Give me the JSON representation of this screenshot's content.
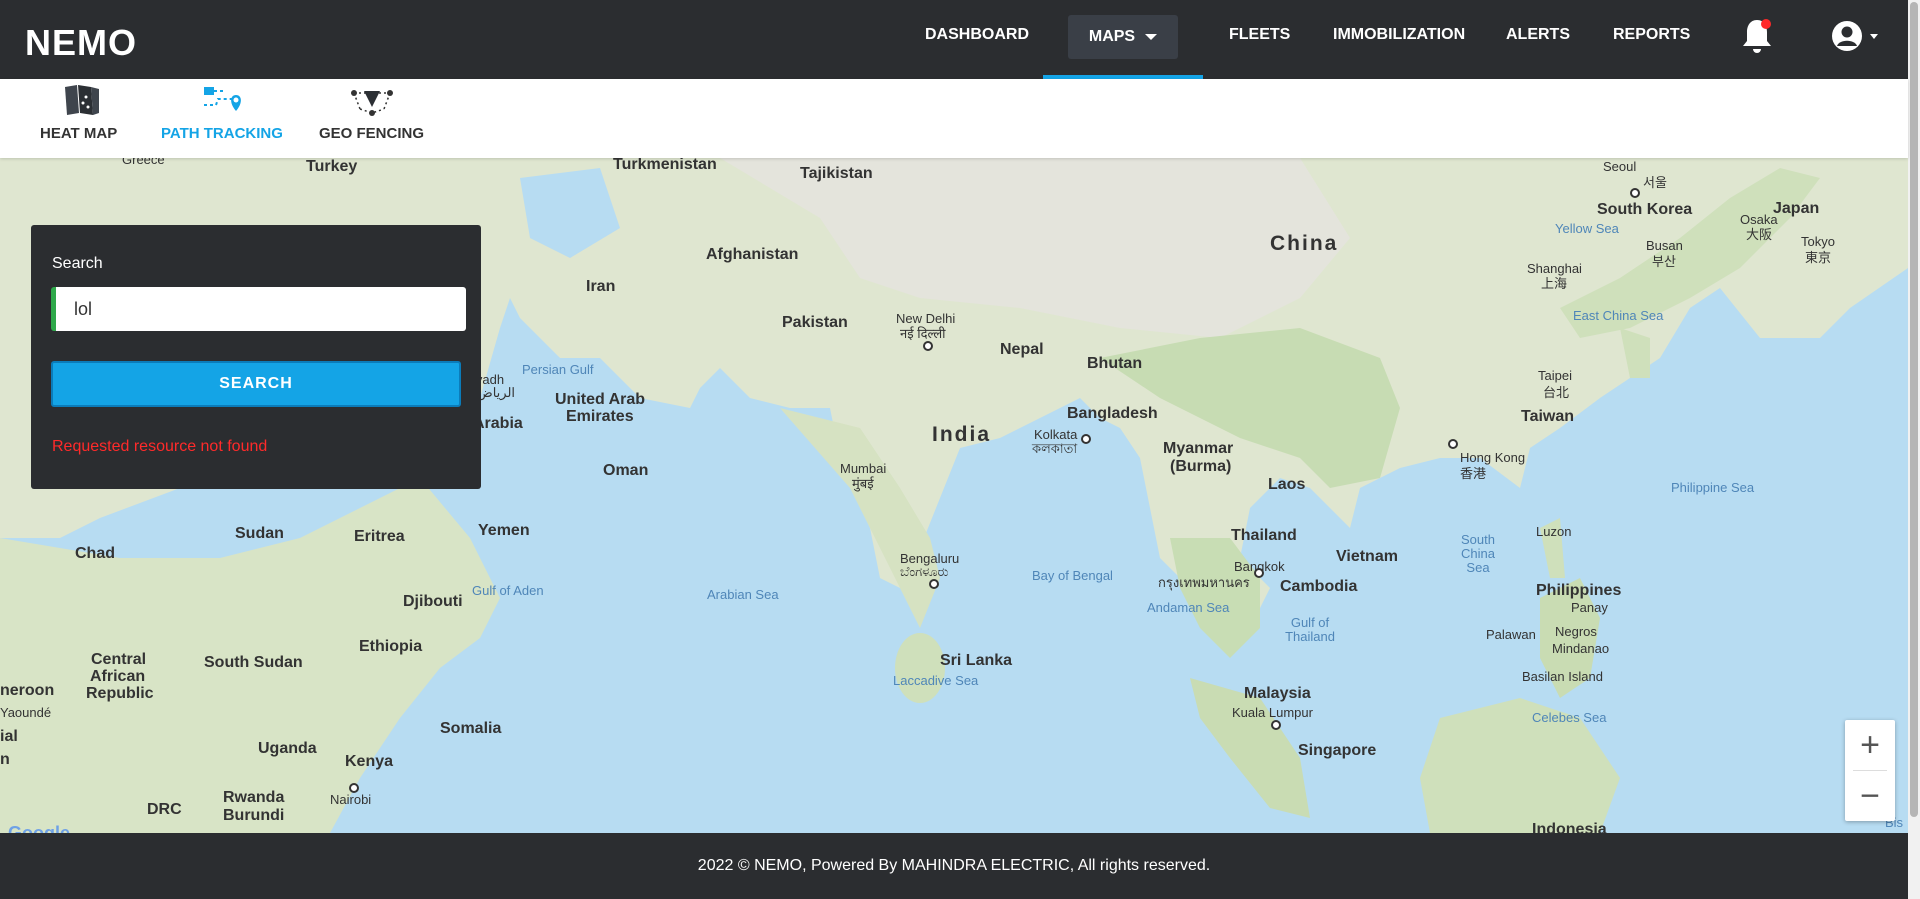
{
  "app": {
    "logo": "NEMO"
  },
  "nav": {
    "items": [
      {
        "label": "DASHBOARD"
      },
      {
        "label": "MAPS"
      },
      {
        "label": "FLEETS"
      },
      {
        "label": "IMMOBILIZATION"
      },
      {
        "label": "ALERTS"
      },
      {
        "label": "REPORTS"
      }
    ],
    "active": "MAPS",
    "accent": "#14a4e6",
    "bell_icon": "bell-icon",
    "account_icon": "user-circle-icon"
  },
  "submenu": {
    "items": [
      {
        "label": "HEAT MAP",
        "icon": "heat-map-icon"
      },
      {
        "label": "PATH TRACKING",
        "icon": "path-tracking-icon"
      },
      {
        "label": "GEO FENCING",
        "icon": "geo-fencing-icon"
      }
    ],
    "active": "PATH TRACKING"
  },
  "search": {
    "label": "Search",
    "value": "lol",
    "button_label": "SEARCH",
    "error": "Requested resource not found",
    "error_color": "#ff2a2a"
  },
  "map": {
    "labels": {
      "greece": "Greece",
      "turkey": "Turkey",
      "turkmenistan": "Turkmenistan",
      "tajikistan": "Tajikistan",
      "afghanistan": "Afghanistan",
      "iran": "Iran",
      "pakistan": "Pakistan",
      "china": "China",
      "new_delhi": "New Delhi",
      "new_delhi_hi": "नई दिल्ली",
      "nepal": "Nepal",
      "bhutan": "Bhutan",
      "bangladesh": "Bangladesh",
      "india": "India",
      "kolkata": "Kolkata",
      "kolkata_bn": "কলকাতা",
      "mumbai": "Mumbai",
      "mumbai_mr": "मुंबई",
      "myanmar": "Myanmar",
      "burma": "(Burma)",
      "laos": "Laos",
      "thailand": "Thailand",
      "vietnam": "Vietnam",
      "cambodia": "Cambodia",
      "bangkok": "Bangkok",
      "bangkok_th": "กรุงเทพมหานคร",
      "bengaluru": "Bengaluru",
      "bengaluru_kn": "ಬೆಂಗಳೂರು",
      "sri_lanka": "Sri Lanka",
      "laccadive": "Laccadive Sea",
      "arabian_sea": "Arabian Sea",
      "bay_of_bengal": "Bay of Bengal",
      "andaman_sea": "Andaman Sea",
      "gulf_thailand": "Gulf of Thailand",
      "malaysia": "Malaysia",
      "kuala_lumpur": "Kuala Lumpur",
      "singapore": "Singapore",
      "south_korea": "South Korea",
      "seoul": "Seoul",
      "seoul_ko": "서울",
      "japan": "Japan",
      "osaka": "Osaka",
      "osaka_ja": "大阪",
      "tokyo": "Tokyo",
      "tokyo_ja": "東京",
      "busan": "Busan",
      "busan_ko": "부산",
      "yellow_sea": "Yellow Sea",
      "shanghai": "Shanghai",
      "shanghai_zh": "上海",
      "east_china_sea": "East China Sea",
      "taipei": "Taipei",
      "taipei_zh": "台北",
      "taiwan": "Taiwan",
      "hong_kong": "Hong Kong",
      "hong_kong_zh": "香港",
      "philippine_sea": "Philippine Sea",
      "south_china_sea": "South China Sea",
      "luzon": "Luzon",
      "philippines": "Philippines",
      "panay": "Panay",
      "palawan": "Palawan",
      "negros": "Negros",
      "mindanao": "Mindanao",
      "basilan": "Basilan Island",
      "celebes": "Celebes Sea",
      "indonesia": "Indonesia",
      "uae": "United Arab",
      "emirates": "Emirates",
      "persian_gulf": "Persian Gulf",
      "riyadh": "iyadh",
      "riyadh_ar": "الرياض",
      "arabia": "Arabia",
      "oman": "Oman",
      "yemen": "Yemen",
      "eritrea": "Eritrea",
      "sudan": "Sudan",
      "chad": "Chad",
      "djibouti": "Djibouti",
      "gulf_aden": "Gulf of Aden",
      "ethiopia": "Ethiopia",
      "south_sudan": "South Sudan",
      "central": "Central",
      "african": "African",
      "republic": "Republic",
      "yaounde": "Yaoundé",
      "cameroon": "neroon",
      "somalia": "Somalia",
      "uganda": "Uganda",
      "kenya": "Kenya",
      "nairobi": "Nairobi",
      "rwanda": "Rwanda",
      "burundi": "Burundi",
      "drc": "DRC",
      "ial": "ial",
      "n": "n",
      "bis": "Bis"
    },
    "zoom_in": "+",
    "zoom_out": "−",
    "attribution": "Google"
  },
  "footer": {
    "text": "2022 © NEMO, Powered By MAHINDRA ELECTRIC, All rights reserved."
  }
}
